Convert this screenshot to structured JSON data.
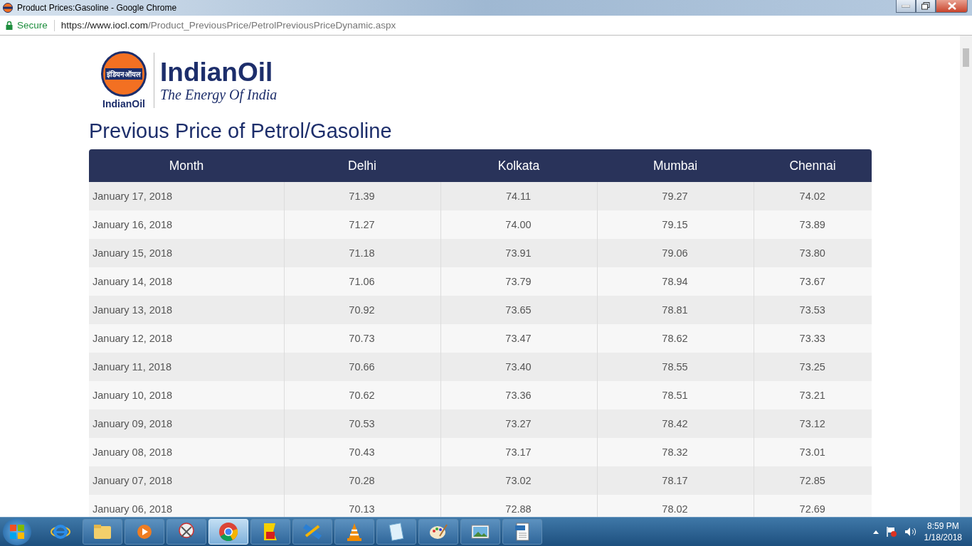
{
  "window": {
    "title": "Product Prices:Gasoline - Google Chrome"
  },
  "address_bar": {
    "security": "Secure",
    "url_host": "https://www.iocl.com",
    "url_path": "/Product_PreviousPrice/PetrolPreviousPriceDynamic.aspx"
  },
  "logo": {
    "badge_text": "इंडियनऑयल",
    "badge_caption": "IndianOil",
    "wordmark": "IndianOil",
    "tagline": "The Energy Of India"
  },
  "page": {
    "heading": "Previous Price of Petrol/Gasoline"
  },
  "table": {
    "columns": [
      "Month",
      "Delhi",
      "Kolkata",
      "Mumbai",
      "Chennai"
    ],
    "rows": [
      [
        "January 17, 2018",
        "71.39",
        "74.11",
        "79.27",
        "74.02"
      ],
      [
        "January 16, 2018",
        "71.27",
        "74.00",
        "79.15",
        "73.89"
      ],
      [
        "January 15, 2018",
        "71.18",
        "73.91",
        "79.06",
        "73.80"
      ],
      [
        "January 14, 2018",
        "71.06",
        "73.79",
        "78.94",
        "73.67"
      ],
      [
        "January 13, 2018",
        "70.92",
        "73.65",
        "78.81",
        "73.53"
      ],
      [
        "January 12, 2018",
        "70.73",
        "73.47",
        "78.62",
        "73.33"
      ],
      [
        "January 11, 2018",
        "70.66",
        "73.40",
        "78.55",
        "73.25"
      ],
      [
        "January 10, 2018",
        "70.62",
        "73.36",
        "78.51",
        "73.21"
      ],
      [
        "January 09, 2018",
        "70.53",
        "73.27",
        "78.42",
        "73.12"
      ],
      [
        "January 08, 2018",
        "70.43",
        "73.17",
        "78.32",
        "73.01"
      ],
      [
        "January 07, 2018",
        "70.28",
        "73.02",
        "78.17",
        "72.85"
      ],
      [
        "January 06, 2018",
        "70.13",
        "72.88",
        "78.02",
        "72.69"
      ]
    ]
  },
  "taskbar": {
    "apps": [
      {
        "kind": "ie",
        "selected": false
      },
      {
        "kind": "folder",
        "selected": false
      },
      {
        "kind": "media",
        "selected": false
      },
      {
        "kind": "scissors",
        "selected": false
      },
      {
        "kind": "chrome",
        "selected": true
      },
      {
        "kind": "flag",
        "selected": false
      },
      {
        "kind": "film",
        "selected": false
      },
      {
        "kind": "cone",
        "selected": false
      },
      {
        "kind": "notepad",
        "selected": false
      },
      {
        "kind": "paint",
        "selected": false
      },
      {
        "kind": "photo",
        "selected": false
      },
      {
        "kind": "document",
        "selected": false
      }
    ],
    "time": "8:59 PM",
    "date": "1/18/2018"
  }
}
